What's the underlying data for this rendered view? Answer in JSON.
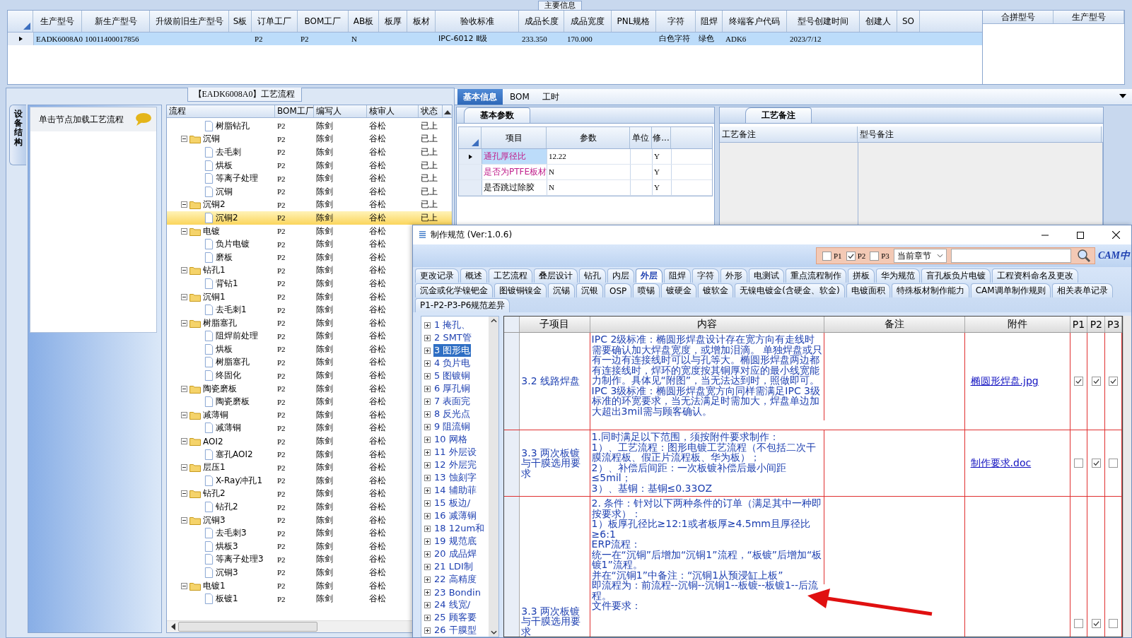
{
  "main_info": {
    "title": "主要信息",
    "columns": [
      "生产型号",
      "新生产型号",
      "升级前旧生产型号",
      "S板",
      "订单工厂",
      "BOM工厂",
      "AB板",
      "板厚",
      "板材",
      "验收标准",
      "成品长度",
      "成品宽度",
      "PNL规格",
      "字符",
      "阻焊",
      "终端客户代码",
      "型号创建时间",
      "创建人",
      "SO"
    ],
    "rows": [
      {
        "selected": true,
        "cells": [
          "EADK6008A0",
          "10011400017856",
          null,
          null,
          "P2",
          "P2",
          "N",
          null,
          null,
          "IPC-6012 Ⅱ级",
          "233.350",
          "170.000",
          null,
          "白色字符",
          "绿色",
          "ADK6",
          "2023/7/12",
          null,
          null
        ]
      }
    ],
    "side_columns": [
      "合拼型号",
      "生产型号"
    ]
  },
  "process_panel": {
    "title": "【EADK6008A0】工艺流程",
    "side_tab": "设备结构",
    "hint": "单击节点加载工艺流程",
    "columns": [
      "流程",
      "BOM工厂",
      "编写人",
      "核审人",
      "状态"
    ],
    "tree": [
      {
        "children": [
          {
            "label": "树脂钻孔",
            "bom": "P2",
            "writer": "陈剑",
            "reviewer": "谷松",
            "status": "已上",
            "selected": false
          }
        ]
      },
      {
        "label": "沉铜",
        "bom": "P2",
        "writer": "陈剑",
        "reviewer": "谷松",
        "status": "已上",
        "selected": false,
        "expanded": true,
        "children": [
          {
            "label": "去毛刺",
            "bom": "P2",
            "writer": "陈剑",
            "reviewer": "谷松",
            "status": "已上",
            "selected": false
          },
          {
            "label": "烘板",
            "bom": "P2",
            "writer": "陈剑",
            "reviewer": "谷松",
            "status": "已上",
            "selected": false
          },
          {
            "label": "等离子处理",
            "bom": "P2",
            "writer": "陈剑",
            "reviewer": "谷松",
            "status": "已上",
            "selected": false
          },
          {
            "label": "沉铜",
            "bom": "P2",
            "writer": "陈剑",
            "reviewer": "谷松",
            "status": "已上",
            "selected": false
          }
        ]
      },
      {
        "label": "沉铜2",
        "bom": "P2",
        "writer": "陈剑",
        "reviewer": "谷松",
        "status": "已上",
        "selected": false,
        "expanded": true,
        "children": [
          {
            "label": "沉铜2",
            "bom": "P2",
            "writer": "陈剑",
            "reviewer": "谷松",
            "status": "已上",
            "selected": true
          }
        ]
      },
      {
        "label": "电镀",
        "bom": "P2",
        "writer": "陈剑",
        "reviewer": "谷松",
        "selected": false,
        "expanded": true,
        "children": [
          {
            "label": "负片电镀",
            "bom": "P2",
            "writer": "陈剑",
            "reviewer": "谷松",
            "selected": false
          },
          {
            "label": "磨板",
            "bom": "P2",
            "writer": "陈剑",
            "reviewer": "谷松",
            "selected": false
          }
        ]
      },
      {
        "label": "钻孔1",
        "bom": "P2",
        "writer": "陈剑",
        "reviewer": "谷松",
        "selected": false,
        "expanded": true,
        "children": [
          {
            "label": "背钻1",
            "bom": "P2",
            "writer": "陈剑",
            "reviewer": "谷松",
            "selected": false
          }
        ]
      },
      {
        "label": "沉铜1",
        "bom": "P2",
        "writer": "陈剑",
        "reviewer": "谷松",
        "selected": false,
        "expanded": true,
        "children": [
          {
            "label": "去毛刺1",
            "bom": "P2",
            "writer": "陈剑",
            "reviewer": "谷松",
            "selected": false
          }
        ]
      },
      {
        "label": "树脂塞孔",
        "bom": "P2",
        "writer": "陈剑",
        "reviewer": "谷松",
        "selected": false,
        "expanded": true,
        "children": [
          {
            "label": "阻焊前处理",
            "bom": "P2",
            "writer": "陈剑",
            "reviewer": "谷松",
            "selected": false
          },
          {
            "label": "烘板",
            "bom": "P2",
            "writer": "陈剑",
            "reviewer": "谷松",
            "selected": false
          },
          {
            "label": "树脂塞孔",
            "bom": "P2",
            "writer": "陈剑",
            "reviewer": "谷松",
            "selected": false
          },
          {
            "label": "终固化",
            "bom": "P2",
            "writer": "陈剑",
            "reviewer": "谷松",
            "selected": false
          }
        ]
      },
      {
        "label": "陶瓷磨板",
        "bom": "P2",
        "writer": "陈剑",
        "reviewer": "谷松",
        "selected": false,
        "expanded": true,
        "children": [
          {
            "label": "陶瓷磨板",
            "bom": "P2",
            "writer": "陈剑",
            "reviewer": "谷松",
            "selected": false
          }
        ]
      },
      {
        "label": "减薄铜",
        "bom": "P2",
        "writer": "陈剑",
        "reviewer": "谷松",
        "selected": false,
        "expanded": true,
        "children": [
          {
            "label": "减薄铜",
            "bom": "P2",
            "writer": "陈剑",
            "reviewer": "谷松",
            "selected": false
          }
        ]
      },
      {
        "label": "AOI2",
        "bom": "P2",
        "writer": "陈剑",
        "reviewer": "谷松",
        "selected": false,
        "expanded": true,
        "children": [
          {
            "label": "塞孔AOI2",
            "bom": "P2",
            "writer": "陈剑",
            "reviewer": "谷松",
            "selected": false
          }
        ]
      },
      {
        "label": "层压1",
        "bom": "P2",
        "writer": "陈剑",
        "reviewer": "谷松",
        "selected": false,
        "expanded": true,
        "children": [
          {
            "label": "X-Ray冲孔1",
            "bom": "P2",
            "writer": "陈剑",
            "reviewer": "谷松",
            "selected": false
          }
        ]
      },
      {
        "label": "钻孔2",
        "bom": "P2",
        "writer": "陈剑",
        "reviewer": "谷松",
        "selected": false,
        "expanded": true,
        "children": [
          {
            "label": "钻孔2",
            "bom": "P2",
            "writer": "陈剑",
            "reviewer": "谷松",
            "selected": false
          }
        ]
      },
      {
        "label": "沉铜3",
        "bom": "P2",
        "writer": "陈剑",
        "reviewer": "谷松",
        "selected": false,
        "expanded": true,
        "children": [
          {
            "label": "去毛刺3",
            "bom": "P2",
            "writer": "陈剑",
            "reviewer": "谷松",
            "selected": false
          },
          {
            "label": "烘板3",
            "bom": "P2",
            "writer": "陈剑",
            "reviewer": "谷松",
            "selected": false
          },
          {
            "label": "等离子处理3",
            "bom": "P2",
            "writer": "陈剑",
            "reviewer": "谷松",
            "selected": false
          },
          {
            "label": "沉铜3",
            "bom": "P2",
            "writer": "陈剑",
            "reviewer": "谷松",
            "selected": false
          }
        ]
      },
      {
        "label": "电镀1",
        "bom": "P2",
        "writer": "陈剑",
        "reviewer": "谷松",
        "selected": false,
        "expanded": true,
        "children": [
          {
            "label": "板镀1",
            "bom": "P2",
            "writer": "陈剑",
            "reviewer": "谷松",
            "selected": false
          }
        ]
      }
    ]
  },
  "detail_panel": {
    "tabs": [
      {
        "label": "基本信息",
        "selected": true
      },
      {
        "label": "BOM",
        "selected": false
      },
      {
        "label": "工时",
        "selected": false
      }
    ],
    "params": {
      "tab": "基本参数",
      "columns": [
        "项目",
        "参数",
        "单位",
        "修..."
      ],
      "rows": [
        {
          "item": "通孔厚径比",
          "value": "12.22",
          "flag": "Y",
          "highlighted": true,
          "selected": true
        },
        {
          "item": "是否为PTFE板材",
          "value": "N",
          "flag": "Y",
          "highlighted": true,
          "selected": false
        },
        {
          "item": "是否跳过除胶",
          "value": "N",
          "flag": "Y",
          "highlighted": false,
          "selected": false
        }
      ]
    },
    "notes": {
      "tab": "工艺备注",
      "columns": [
        "工艺备注",
        "型号备注"
      ]
    }
  },
  "spec_window": {
    "title": "制作规范 (Ver:1.0.6)",
    "filters": [
      {
        "label": "P1",
        "checked": false
      },
      {
        "label": "P2",
        "checked": true
      },
      {
        "label": "P3",
        "checked": false
      }
    ],
    "scope": "当前章节",
    "logo": "CAM中",
    "tab_rows": [
      [
        {
          "label": "更改记录",
          "selected": false
        },
        {
          "label": "概述",
          "selected": false
        },
        {
          "label": "工艺流程",
          "selected": false
        },
        {
          "label": "叠层设计",
          "selected": false
        },
        {
          "label": "钻孔",
          "selected": false
        },
        {
          "label": "内层",
          "selected": false
        },
        {
          "label": "外层",
          "selected": true
        },
        {
          "label": "阻焊",
          "selected": false
        },
        {
          "label": "字符",
          "selected": false
        },
        {
          "label": "外形",
          "selected": false
        },
        {
          "label": "电测试",
          "selected": false
        },
        {
          "label": "重点流程制作",
          "selected": false
        },
        {
          "label": "拼板",
          "selected": false
        },
        {
          "label": "华为规范",
          "selected": false
        },
        {
          "label": "盲孔板负片电镀",
          "selected": false
        },
        {
          "label": "工程资料命名及更改",
          "selected": false
        }
      ],
      [
        {
          "label": "沉金或化学镍钯金",
          "selected": false
        },
        {
          "label": "图镀铜镍金",
          "selected": false
        },
        {
          "label": "沉锡",
          "selected": false
        },
        {
          "label": "沉银",
          "selected": false
        },
        {
          "label": "OSP",
          "selected": false
        },
        {
          "label": "喷锡",
          "selected": false
        },
        {
          "label": "镀硬金",
          "selected": false
        },
        {
          "label": "镀软金",
          "selected": false
        },
        {
          "label": "无镍电镀金(含硬金、软金)",
          "selected": false
        },
        {
          "label": "电镀面积",
          "selected": false
        },
        {
          "label": "特殊板材制作能力",
          "selected": false
        },
        {
          "label": "CAM调单制作规则",
          "selected": false
        },
        {
          "label": "相关表单记录",
          "selected": false
        }
      ],
      [
        {
          "label": "P1-P2-P3-P6规范差异",
          "selected": false
        }
      ]
    ],
    "chapters": [
      {
        "label": "1 掩孔、",
        "selected": false,
        "expanded": false
      },
      {
        "label": "2 SMT管",
        "selected": false,
        "expanded": false
      },
      {
        "label": "3 图形电",
        "selected": true,
        "expanded": false
      },
      {
        "label": "4 负片电",
        "selected": false,
        "expanded": false
      },
      {
        "label": "5 图镀铜",
        "selected": false,
        "expanded": false
      },
      {
        "label": "6 厚孔铜",
        "selected": false,
        "expanded": false
      },
      {
        "label": "7 表面完",
        "selected": false,
        "expanded": false
      },
      {
        "label": "8 反光点",
        "selected": false,
        "expanded": false
      },
      {
        "label": "9 阻流铜",
        "selected": false,
        "expanded": false
      },
      {
        "label": "10 网格",
        "selected": false,
        "expanded": false
      },
      {
        "label": "11 外层设",
        "selected": false,
        "expanded": false
      },
      {
        "label": "12 外层完",
        "selected": false,
        "expanded": false
      },
      {
        "label": "13 蚀刻字",
        "selected": false,
        "expanded": false
      },
      {
        "label": "14 辅助菲",
        "selected": false,
        "expanded": false
      },
      {
        "label": "15 板边/",
        "selected": false,
        "expanded": false
      },
      {
        "label": "16 减薄铜",
        "selected": false,
        "expanded": false
      },
      {
        "label": "18 12um和",
        "selected": false,
        "expanded": false
      },
      {
        "label": "19 规范底",
        "selected": false,
        "expanded": false
      },
      {
        "label": "20 成品焊",
        "selected": false,
        "expanded": false
      },
      {
        "label": "21 LDI制",
        "selected": false,
        "expanded": false
      },
      {
        "label": "22 高精度",
        "selected": false,
        "expanded": false
      },
      {
        "label": "23 Bondin",
        "selected": false,
        "expanded": false
      },
      {
        "label": "24 线宽/",
        "selected": false,
        "expanded": false
      },
      {
        "label": "25 顾客要",
        "selected": false,
        "expanded": false
      },
      {
        "label": "26 干膜型",
        "selected": false,
        "expanded": false
      }
    ],
    "columns": [
      "子项目",
      "内容",
      "备注",
      "附件",
      "P1",
      "P2",
      "P3"
    ],
    "rows": [
      {
        "sub_item": "3.2 线路焊盘",
        "blocks": [
          [
            "IPC 2级标准：椭圆形焊盘设计存在宽方向有走线时需要确认加大焊盘宽度，或增加泪滴。 单独焊盘或只有一边有连接线时可以与孔等大。椭圆形焊盘两边都有连接线时，焊环的宽度按其铜厚对应的最小线宽能力制作。具体见“附图”，当无法达到时，照做即可。",
            "IPC 3级标准：椭圆形焊盘宽方向同样需满足IPC 3级标准的环宽要求，当无法满足时需加大，焊盘单边加大超出3mil需与顾客确认。"
          ]
        ],
        "attachment": "椭圆形焊盘.jpg",
        "p1": true,
        "p2": true,
        "p3": true
      },
      {
        "sub_item": "3.3 两次板镀与干膜选用要求",
        "blocks": [
          [
            "1.同时满足以下范围，须按附件要求制作：",
            "1）、工艺流程：图形电镀工艺流程（不包括二次干膜流程板、假正片流程板、华为板）；",
            "2）、补偿后间距：一次板镀补偿后最小间距≤5mil；",
            "3）、基铜：基铜≤0.33OZ"
          ]
        ],
        "attachment": "制作要求.doc",
        "p1": false,
        "p2": true,
        "p3": false
      },
      {
        "sub_item": "3.3 两次板镀与干膜选用要求",
        "blocks": [
          [
            "2. 条件：针对以下两种条件的订单（满足其中一种即按要求）：",
            "1）板厚孔径比≥12:1或者板厚≥4.5mm且厚径比≥6:1"
          ],
          [
            "ERP流程：",
            "统一在“沉铜”后增加“沉铜1”流程，“板镀”后增加“板镀1”流程。",
            "并在“沉铜1”中备注：“沉铜1从预浸缸上板”",
            "即流程为：前流程--沉铜--沉铜1--板镀--板镀1--后流程。"
          ],
          [
            "文件要求："
          ]
        ],
        "p1": false,
        "p2": true,
        "p3": false
      }
    ]
  }
}
